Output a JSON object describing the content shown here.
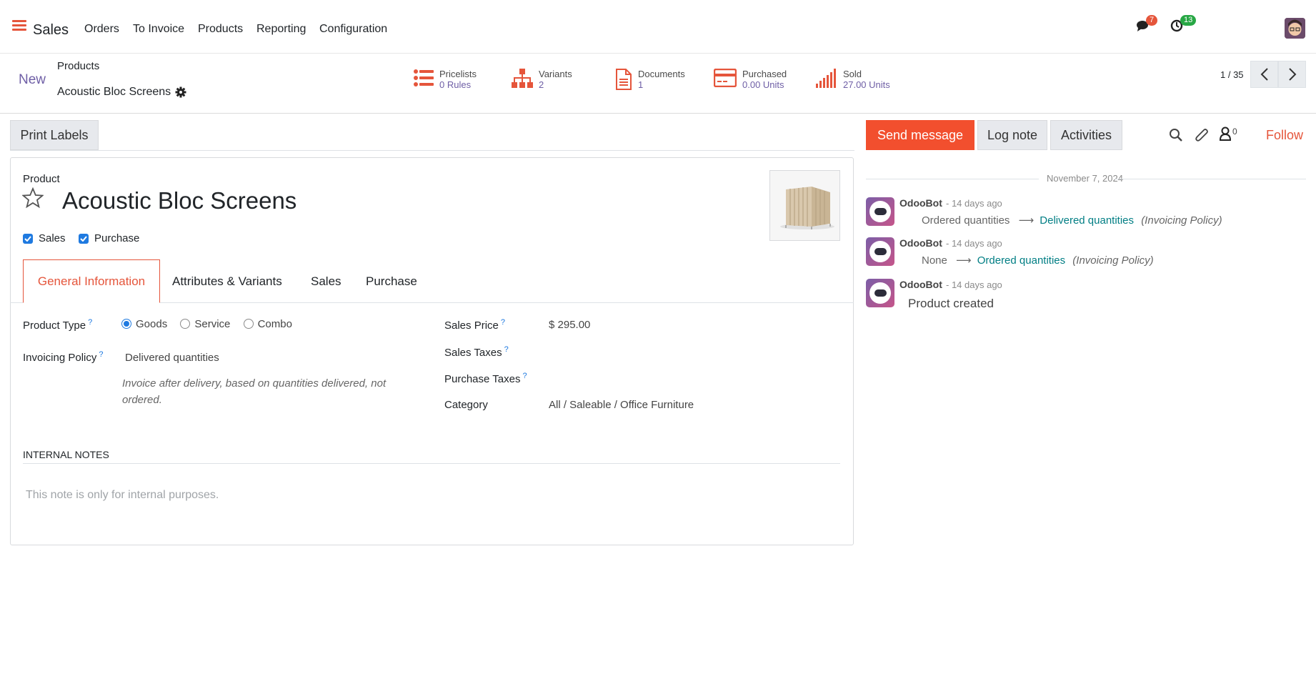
{
  "topbar": {
    "app_name": "Sales",
    "nav": [
      "Orders",
      "To Invoice",
      "Products",
      "Reporting",
      "Configuration"
    ],
    "messages_count": "7",
    "activities_count": "13",
    "accent_color": "#e5553b"
  },
  "control": {
    "new_label": "New",
    "breadcrumb_parent": "Products",
    "breadcrumb_current": "Acoustic Bloc Screens",
    "pager": "1 / 35",
    "smart_buttons": [
      {
        "label": "Pricelists",
        "value": "0 Rules",
        "icon": "list-icon"
      },
      {
        "label": "Variants",
        "value": "2",
        "icon": "sitemap-icon"
      },
      {
        "label": "Documents",
        "value": "1",
        "icon": "document-icon"
      },
      {
        "label": "Purchased",
        "value": "0.00 Units",
        "icon": "credit-card-icon"
      },
      {
        "label": "Sold",
        "value": "27.00 Units",
        "icon": "signal-icon"
      }
    ]
  },
  "form": {
    "print_labels": "Print Labels",
    "product_label": "Product",
    "product_name": "Acoustic Bloc Screens",
    "can_be_sold": "Sales",
    "can_be_purchased": "Purchase",
    "tabs": [
      "General Information",
      "Attributes & Variants",
      "Sales",
      "Purchase"
    ],
    "product_type_label": "Product Type",
    "product_type_options": [
      "Goods",
      "Service",
      "Combo"
    ],
    "product_type_selected": "Goods",
    "invoicing_policy_label": "Invoicing Policy",
    "invoicing_policy_value": "Delivered quantities",
    "invoicing_help": "Invoice after delivery, based on quantities delivered, not ordered.",
    "sales_price_label": "Sales Price",
    "sales_price_value": "$ 295.00",
    "sales_taxes_label": "Sales Taxes",
    "purchase_taxes_label": "Purchase Taxes",
    "category_label": "Category",
    "category_value": "All / Saleable / Office Furniture",
    "internal_notes_header": "INTERNAL NOTES",
    "internal_notes_placeholder": "This note is only for internal purposes."
  },
  "chatter": {
    "send_message": "Send message",
    "log_note": "Log note",
    "activities": "Activities",
    "followers_count": "0",
    "follow": "Follow",
    "date": "November 7, 2024",
    "messages": [
      {
        "author": "OdooBot",
        "when": "- 14 days ago",
        "old": "Ordered quantities",
        "new": "Delivered quantities",
        "field": "(Invoicing Policy)"
      },
      {
        "author": "OdooBot",
        "when": "- 14 days ago",
        "old": "None",
        "new": "Ordered quantities",
        "field": "(Invoicing Policy)"
      },
      {
        "author": "OdooBot",
        "when": "- 14 days ago",
        "text": "Product created"
      }
    ]
  }
}
